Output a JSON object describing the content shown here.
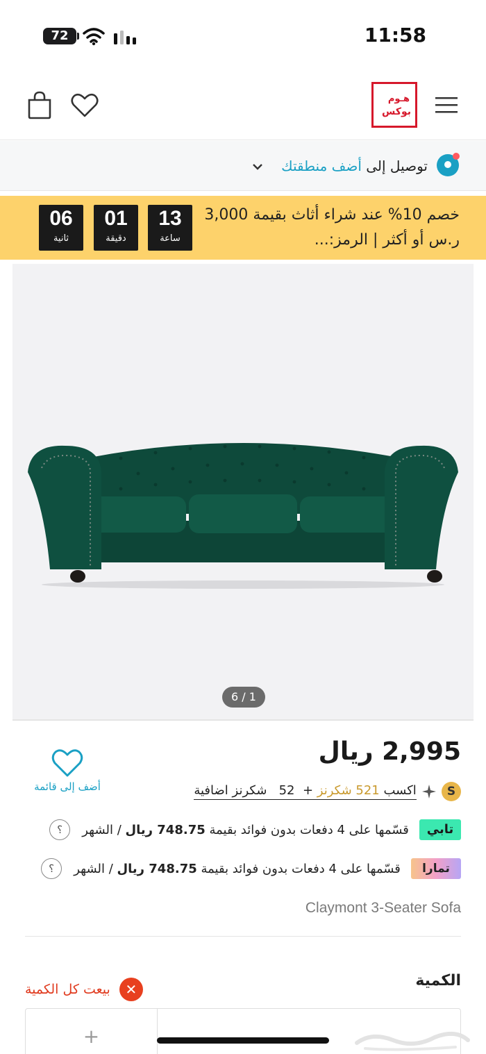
{
  "status_bar": {
    "battery": "72",
    "time": "11:58"
  },
  "header": {
    "logo_line1": "هـوم",
    "logo_line2": "بوكس",
    "icons": [
      "menu-icon",
      "logo",
      "bag-icon",
      "heart-icon"
    ]
  },
  "delivery": {
    "label": "توصيل إلى",
    "link": "أضف منطقتك"
  },
  "promo": {
    "text": "خصم 10% عند شراء أثاث بقيمة 3,000 ر.س أو أكثر | الرمز:...",
    "timer": [
      {
        "value": "13",
        "label": "ساعة"
      },
      {
        "value": "01",
        "label": "دقيقة"
      },
      {
        "value": "06",
        "label": "ثانية"
      }
    ]
  },
  "gallery": {
    "pager": "6 / 1"
  },
  "product": {
    "price": "2,995 ريال",
    "wishlist_label": "أضف إلى قائمة",
    "earn": {
      "coin": "S",
      "prefix": "اكسب",
      "amount": "521 شكرنز",
      "plus": "+",
      "extra": "52",
      "suffix": "شكرنز اضافية"
    },
    "tabby": {
      "logo": "تابي",
      "text_before": "قسّمها على 4 دفعات بدون فوائد بقيمة",
      "amount": "748.75 ريال",
      "text_after": "/ الشهر",
      "help": "؟"
    },
    "tamara": {
      "logo": "تمارا",
      "text_before": "قسّمها على 4 دفعات بدون فوائد بقيمة",
      "amount": "748.75 ريال",
      "text_after": "/ الشهر",
      "help": "؟"
    },
    "name": "Claymont 3-Seater Sofa",
    "quantity_label": "الكمية",
    "soldout_text": "بيعت كل الكمية",
    "qty_plus": "+"
  },
  "colors": {
    "brand_red": "#d6182b",
    "accent_teal": "#1aa0c4",
    "promo_yellow": "#fdd26b",
    "soldout_red": "#e03a1e",
    "sofa_green": "#0f4f3f"
  }
}
